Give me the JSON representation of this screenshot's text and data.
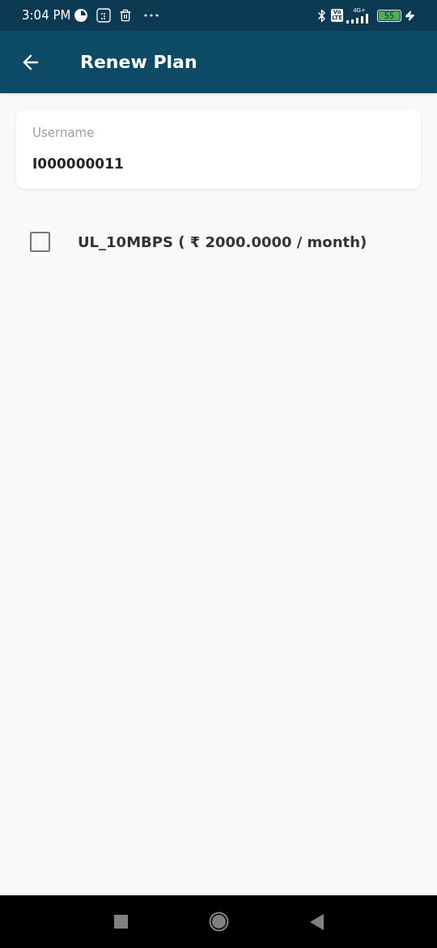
{
  "status_bar": {
    "time": "3:04 PM",
    "volte": [
      "Vo",
      "LTE"
    ],
    "network": "4G+",
    "battery": "55",
    "charging": true
  },
  "app_bar": {
    "title": "Renew Plan"
  },
  "username_field": {
    "label": "Username",
    "value": "I000000011"
  },
  "plans": [
    {
      "label": "UL_10MBPS ( ₹ 2000.0000 / month)",
      "checked": false
    }
  ]
}
